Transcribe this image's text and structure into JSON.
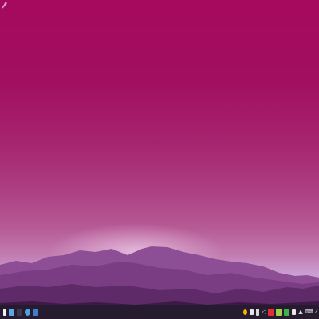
{
  "desktop": {
    "wallpaper": {
      "sky_top": "#a50a5e",
      "sky_bottom": "#c890c4",
      "mountain_colors": [
        "#8e4e95",
        "#7a3c82",
        "#5f2a68",
        "#3d1a45"
      ]
    },
    "corner_tool_icon": "pen-icon"
  },
  "taskbar": {
    "launchers": [
      {
        "name": "launcher-icon",
        "color": "#f2f2f2"
      },
      {
        "name": "file-manager-icon",
        "color": "#5aa8e6"
      },
      {
        "name": "terminal-icon",
        "color": "#3a3a4a"
      },
      {
        "name": "browser-icon",
        "color": "#4aa3e0"
      },
      {
        "name": "settings-icon",
        "color": "#3f7fc9"
      }
    ],
    "tray": [
      {
        "name": "notification-icon",
        "color": "#f0b400"
      },
      {
        "name": "document-icon",
        "color": "#e6e6e6"
      },
      {
        "name": "battery-icon",
        "color": "#d9d9d9"
      },
      {
        "name": "volume-icon",
        "color": "#e0e0e0"
      },
      {
        "name": "record-icon",
        "color": "#e23030"
      },
      {
        "name": "network-icon",
        "color": "#9ad24a"
      },
      {
        "name": "updates-icon",
        "color": "#3fb24a"
      },
      {
        "name": "clipboard-icon",
        "color": "#e8e8e8"
      },
      {
        "name": "tray-expand-icon",
        "color": "#e8e8e8"
      },
      {
        "name": "keyboard-layout-icon",
        "color": "#e8e8e8"
      },
      {
        "name": "show-desktop-icon",
        "color": "#cfcfcf"
      }
    ]
  }
}
